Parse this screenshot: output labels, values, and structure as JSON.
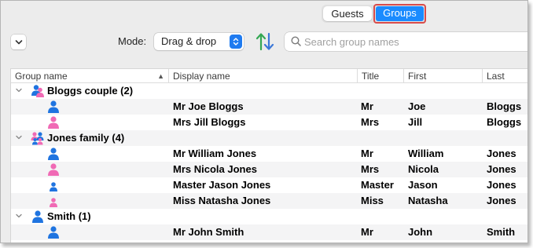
{
  "view_switch": {
    "guests_label": "Guests",
    "groups_label": "Groups"
  },
  "toolbar": {
    "mode_label": "Mode:",
    "mode_value": "Drag & drop",
    "search_placeholder": "Search group names"
  },
  "table": {
    "columns": {
      "group_name": "Group name",
      "display_name": "Display name",
      "title": "Title",
      "first": "First",
      "last": "Last"
    },
    "groups": [
      {
        "name": "Bloggs couple (2)",
        "icon": "couple-icon",
        "members": [
          {
            "display_name": "Mr Joe Bloggs",
            "title": "Mr",
            "first": "Joe",
            "last": "Bloggs",
            "gender": "male"
          },
          {
            "display_name": "Mrs Jill Bloggs",
            "title": "Mrs",
            "first": "Jill",
            "last": "Bloggs",
            "gender": "female"
          }
        ]
      },
      {
        "name": "Jones family (4)",
        "icon": "family-icon",
        "members": [
          {
            "display_name": "Mr William Jones",
            "title": "Mr",
            "first": "William",
            "last": "Jones",
            "gender": "male"
          },
          {
            "display_name": "Mrs Nicola Jones",
            "title": "Mrs",
            "first": "Nicola",
            "last": "Jones",
            "gender": "female"
          },
          {
            "display_name": "Master Jason Jones",
            "title": "Master",
            "first": "Jason",
            "last": "Jones",
            "gender": "male-child"
          },
          {
            "display_name": "Miss Natasha Jones",
            "title": "Miss",
            "first": "Natasha",
            "last": "Jones",
            "gender": "female-child"
          }
        ]
      },
      {
        "name": "Smith (1)",
        "icon": "single-person-icon",
        "members": [
          {
            "display_name": "Mr John Smith",
            "title": "Mr",
            "first": "John",
            "last": "Smith",
            "gender": "male"
          }
        ]
      }
    ]
  },
  "colors": {
    "accent": "#1a8bff",
    "highlight_border": "#d84b4b",
    "male": "#1f74e0",
    "female": "#f06ab5"
  }
}
